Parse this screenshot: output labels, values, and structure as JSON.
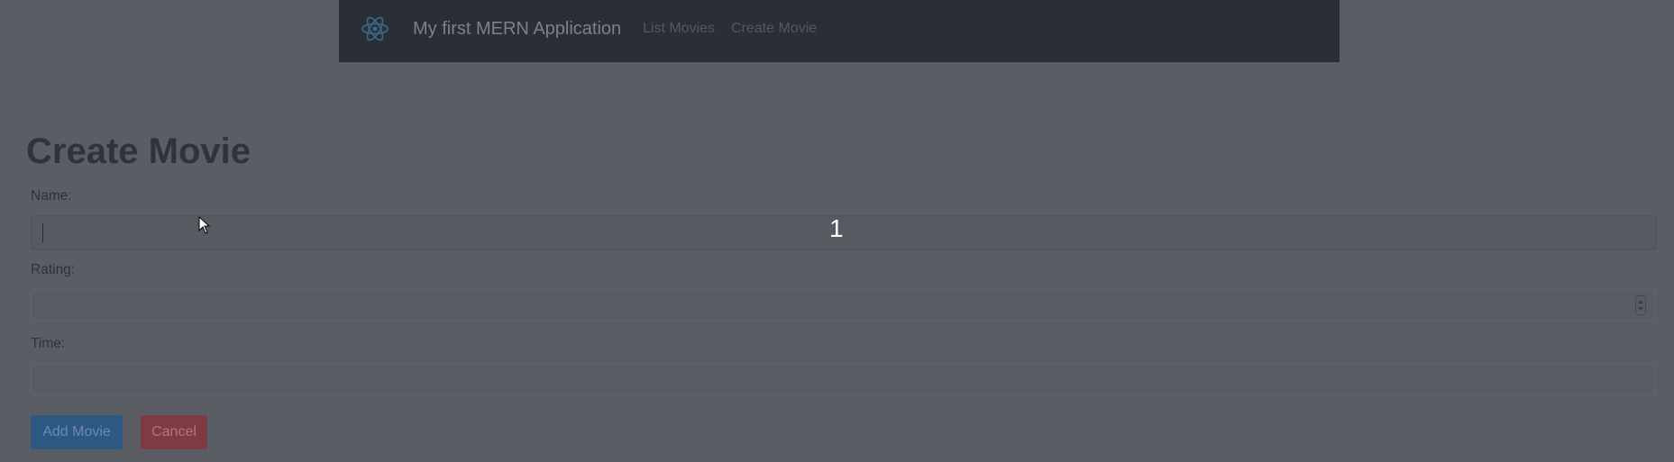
{
  "navbar": {
    "brand": "My first MERN Application",
    "logo_icon": "react-atom-icon",
    "links": [
      "List Movies",
      "Create Movie"
    ]
  },
  "form": {
    "title": "Create Movie",
    "name_label": "Name:",
    "name_value": "",
    "rating_label": "Rating:",
    "rating_value": "",
    "time_label": "Time:",
    "time_value": "",
    "add_button": "Add Movie",
    "cancel_button": "Cancel"
  },
  "overlay_counter": "1",
  "colors": {
    "navbar_bg": "#2a2e35",
    "page_bg": "#5a5d64",
    "add_button_bg": "#2e5884",
    "cancel_button_bg": "#7e3c42",
    "logo_color": "#3a6e86"
  }
}
